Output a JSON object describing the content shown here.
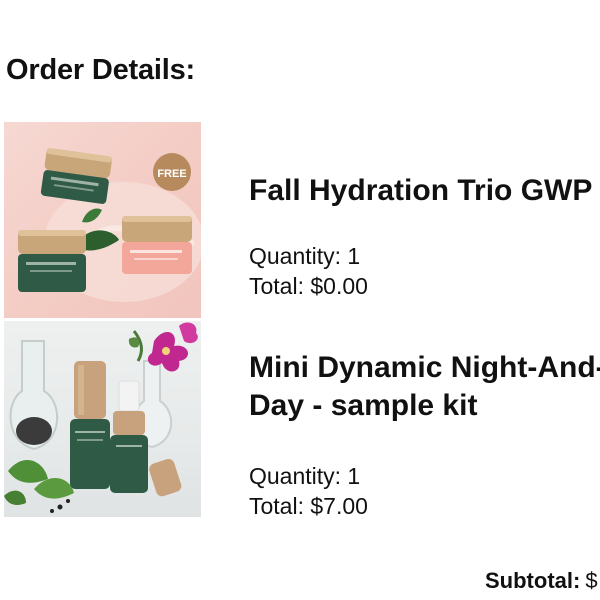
{
  "page": {
    "heading": "Order Details:"
  },
  "items": [
    {
      "name_lines": [
        "Fall Hydration Trio GWP"
      ],
      "quantity": "Quantity: 1",
      "total": "Total: $0.00",
      "badge": "FREE",
      "image_icon": "skincare-jars-image"
    },
    {
      "name_lines": [
        "Mini Dynamic Night-And-",
        "Day - sample kit"
      ],
      "quantity": "Quantity: 1",
      "total": "Total: $7.00",
      "image_icon": "serum-bottles-image"
    }
  ],
  "summary": {
    "subtotal_label": "Subtotal:",
    "subtotal_value": "$"
  },
  "colors": {
    "jar_green": "#2f5a45",
    "jar_gold": "#c9a57a",
    "jar_pink": "#f2a79a",
    "badge_gold": "#b78a5e",
    "flower_magenta": "#c0288f"
  }
}
